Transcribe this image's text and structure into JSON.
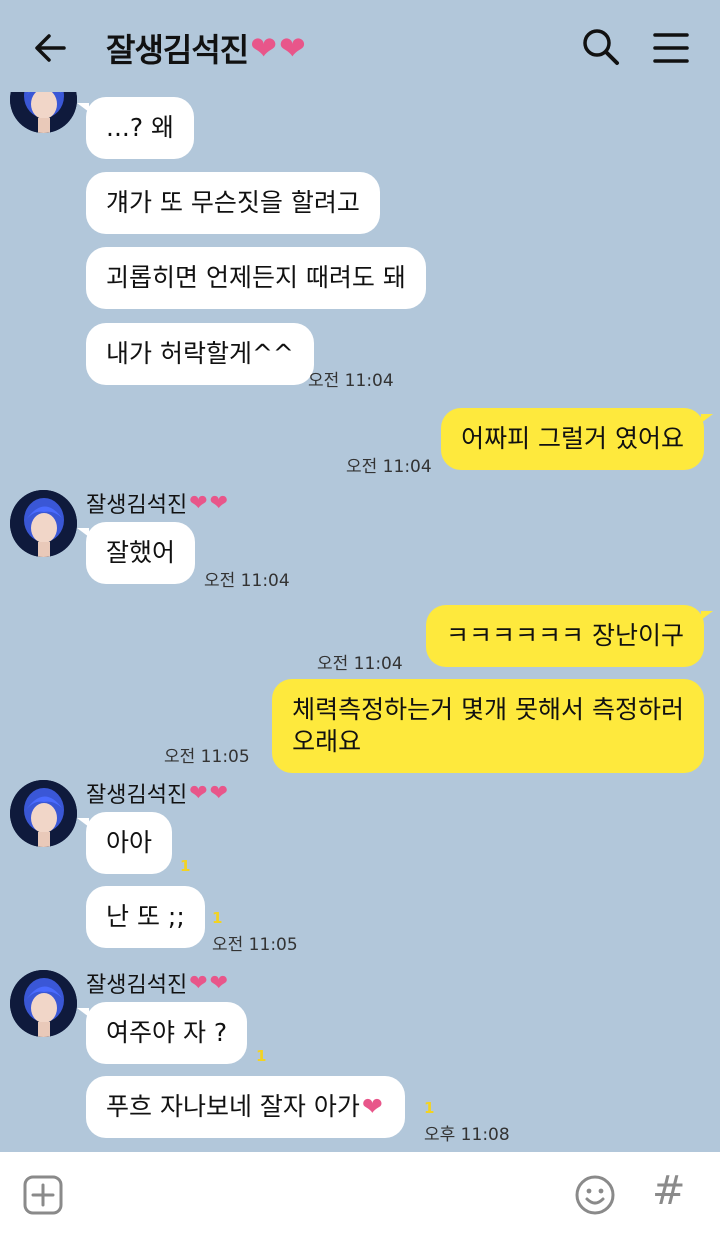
{
  "header": {
    "title": "잘생김석진",
    "title_hearts": "❤❤"
  },
  "messages": {
    "m1": "...? 왜",
    "m2": "걔가 또 무슨짓을 할려고",
    "m3": "괴롭히면 언제든지 때려도 돼",
    "m4": "내가 허락할게^^",
    "m4_time": "오전 11:04",
    "m5": "어짜피 그럴거 였어요",
    "m5_time": "오전 11:04",
    "sender2": "잘생김석진",
    "sender2_hearts": "❤❤",
    "m6": "잘했어",
    "m6_time": "오전 11:04",
    "m7": "ㅋㅋㅋㅋㅋㅋ 장난이구",
    "m7_time": "오전 11:04",
    "m8_line1": "체력측정하는거 몇개 못해서 측정하러",
    "m8_line2": "오래요",
    "m8_time": "오전 11:05",
    "sender3": "잘생김석진",
    "sender3_hearts": "❤❤",
    "m9": "아아",
    "m9_unread": "1",
    "m10": "난 또 ;;",
    "m10_unread": "1",
    "m10_time": "오전 11:05",
    "sender4": "잘생김석진",
    "sender4_hearts": "❤❤",
    "m11": "여주야 자 ?",
    "m11_unread": "1",
    "m12": "푸흐 자나보네 잘자 아가",
    "m12_heart": "❤",
    "m12_unread": "1",
    "m12_time": "오후 11:08"
  },
  "footer": {
    "hash_label": "#"
  },
  "colors": {
    "background": "#b2c7da",
    "incoming_bubble": "#ffffff",
    "outgoing_bubble": "#fee93d",
    "heart": "#e8568a",
    "unread": "#f3d321"
  }
}
